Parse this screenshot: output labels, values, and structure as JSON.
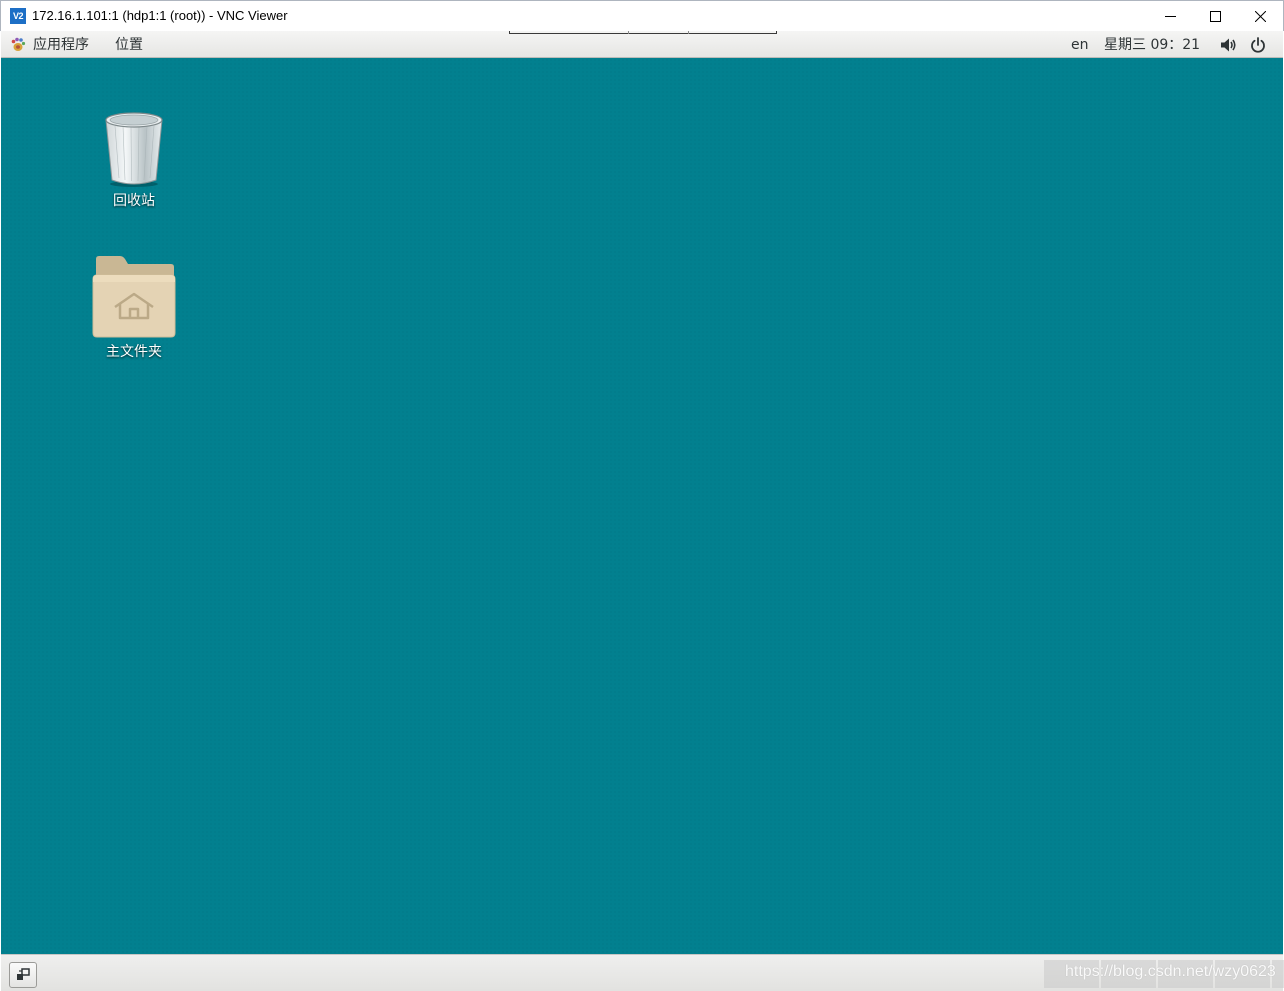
{
  "window": {
    "app_icon_text": "V2",
    "title": "172.16.1.101:1 (hdp1:1 (root)) - VNC Viewer"
  },
  "panel": {
    "applications_label": "应用程序",
    "places_label": "位置",
    "language": "en",
    "clock": "星期三 09：21",
    "icons": [
      "gnome-foot-icon",
      "volume-icon",
      "power-icon"
    ]
  },
  "desktop": {
    "background_color": "#02808f",
    "icons": [
      {
        "name": "trash-icon",
        "label": "回收站"
      },
      {
        "name": "home-folder-icon",
        "label": "主文件夹"
      }
    ]
  },
  "bottom_bar": {
    "watermark": "https://blog.csdn.net/wzy0623"
  }
}
